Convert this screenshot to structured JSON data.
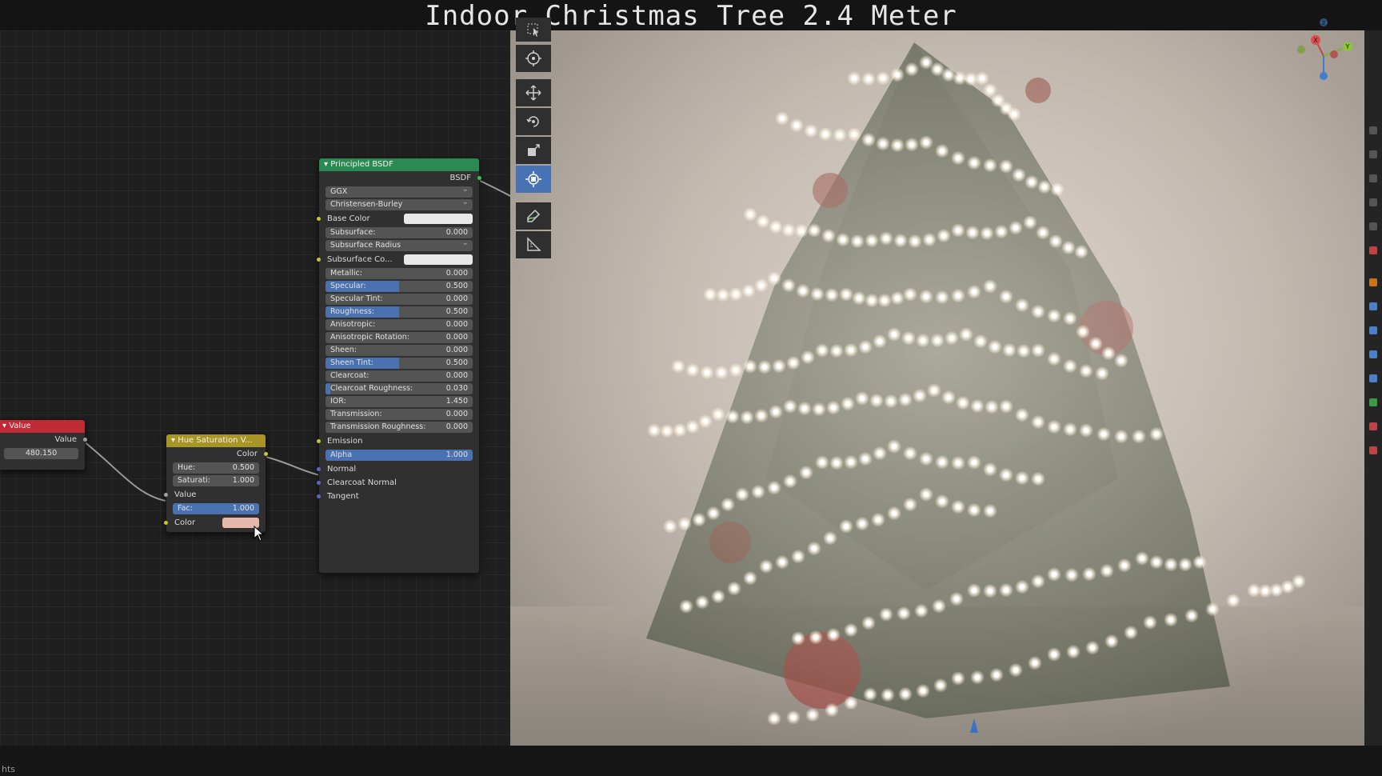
{
  "title": "Indoor Christmas Tree 2.4 Meter",
  "status_text": "hts",
  "value_node": {
    "header": "Value",
    "output_label": "Value",
    "value": "480.150",
    "header_color": "#c02a35"
  },
  "hue_sat_node": {
    "header": "Hue Saturation V...",
    "output_label": "Color",
    "hue_label": "Hue:",
    "hue_value": "0.500",
    "sat_label": "Saturati:",
    "sat_value": "1.000",
    "value_label": "Value",
    "fac_label": "Fac:",
    "fac_value": "1.000",
    "color_label": "Color",
    "header_color": "#a89523",
    "color_swatch": "#e7b8ac"
  },
  "bsdf_node": {
    "header": "Principled BSDF",
    "output_label": "BSDF",
    "distribution": "GGX",
    "subsurface_method": "Christensen-Burley",
    "header_color": "#2a8a52",
    "rows": [
      {
        "label": "Base Color",
        "type": "swatch",
        "color": "#e8e8e8",
        "socket": "yel"
      },
      {
        "label": "Subsurface:",
        "value": "0.000",
        "fill": 0,
        "socket": "grey"
      },
      {
        "label": "Subsurface Radius",
        "type": "dropdown",
        "socket": "vio"
      },
      {
        "label": "Subsurface Co...",
        "type": "swatch",
        "color": "#e8e8e8",
        "socket": "yel"
      },
      {
        "label": "Metallic:",
        "value": "0.000",
        "fill": 0,
        "socket": "grey"
      },
      {
        "label": "Specular:",
        "value": "0.500",
        "fill": 0.5,
        "socket": "grey"
      },
      {
        "label": "Specular Tint:",
        "value": "0.000",
        "fill": 0,
        "socket": "grey"
      },
      {
        "label": "Roughness:",
        "value": "0.500",
        "fill": 0.5,
        "socket": "grey"
      },
      {
        "label": "Anisotropic:",
        "value": "0.000",
        "fill": 0,
        "socket": "grey"
      },
      {
        "label": "Anisotropic Rotation:",
        "value": "0.000",
        "fill": 0,
        "socket": "grey"
      },
      {
        "label": "Sheen:",
        "value": "0.000",
        "fill": 0,
        "socket": "grey"
      },
      {
        "label": "Sheen Tint:",
        "value": "0.500",
        "fill": 0.5,
        "socket": "grey"
      },
      {
        "label": "Clearcoat:",
        "value": "0.000",
        "fill": 0,
        "socket": "grey"
      },
      {
        "label": "Clearcoat Roughness:",
        "value": "0.030",
        "fill": 0.03,
        "socket": "grey"
      },
      {
        "label": "IOR:",
        "value": "1.450",
        "fill": 0,
        "socket": "grey"
      },
      {
        "label": "Transmission:",
        "value": "0.000",
        "fill": 0,
        "socket": "grey"
      },
      {
        "label": "Transmission Roughness:",
        "value": "0.000",
        "fill": 0,
        "socket": "grey"
      },
      {
        "label": "Emission",
        "type": "socket-only",
        "socket": "yel"
      },
      {
        "label": "Alpha",
        "value": "1.000",
        "fill": 1,
        "socket": "grey"
      },
      {
        "label": "Normal",
        "type": "socket-only",
        "socket": "vio"
      },
      {
        "label": "Clearcoat Normal",
        "type": "socket-only",
        "socket": "vio"
      },
      {
        "label": "Tangent",
        "type": "socket-only",
        "socket": "vio"
      }
    ]
  },
  "toolbar": [
    "select-box-icon",
    "cursor-icon",
    "move-icon",
    "rotate-icon",
    "scale-icon",
    "transform-icon",
    "annotate-icon",
    "measure-icon"
  ],
  "gizmo": {
    "x_label": "X",
    "y_label": "Y",
    "z_label": "Z"
  }
}
